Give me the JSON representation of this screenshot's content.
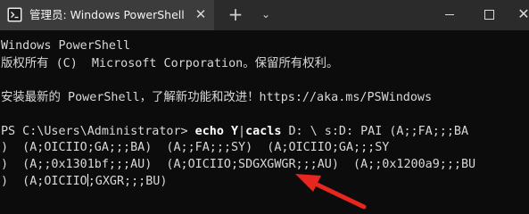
{
  "window": {
    "tab_title": "管理员: Windows PowerShell",
    "tab_close_glyph": "✕",
    "new_tab_glyph": "+",
    "dropdown_glyph": "⌄",
    "close_glyph": "✕"
  },
  "terminal": {
    "line1": "Windows PowerShell",
    "line2": "版权所有 (C)  Microsoft Corporation。保留所有权利。",
    "line3": "安装最新的 PowerShell，了解新功能和改进！https://aka.ms/PSWindows",
    "prompt": "PS C:\\Users\\Administrator> ",
    "cmd_echo": "echo",
    "cmd_y": " Y",
    "cmd_pipe": "|",
    "cmd_cacls": "cacls",
    "cmd_args": " D: \\ s:D: PAI (A;;FA;;;BA",
    "line5": ")  (A;OICIIO;GA;;;BA)  (A;;FA;;;SY)  (A;OICIIO;GA;;;SY",
    "line6": ")  (A;;0x1301bf;;;AU)  (A;OICIIO;SDGXGWGR;;;AU)  (A;;0x1200a9;;;BU",
    "line7_a": ")  (A;OICIIO",
    "line7_b": ";GXGR;;;BU)"
  },
  "annotation": {
    "arrow_color": "#e8261f"
  }
}
